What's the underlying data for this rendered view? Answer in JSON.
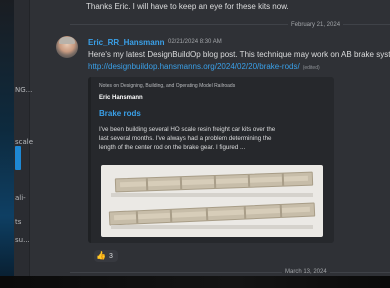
{
  "previous_message": {
    "text": "Thanks Eric.  I will have to keep an eye for these kits now."
  },
  "dividers": {
    "first_date": "February 21, 2024",
    "second_date": "March 13, 2024"
  },
  "sidebar": {
    "items": [
      {
        "label": "NG..."
      },
      {
        "label": "scale"
      },
      {
        "label": "ali-"
      },
      {
        "label": "ts"
      },
      {
        "label": "su..."
      }
    ]
  },
  "message": {
    "author": "Eric_RR_Hansmann",
    "timestamp": "02/21/2024 8:30 AM",
    "text": "Here's my latest DesignBuildOp blog post. This technique may work on AB brake systems",
    "link": "http://designbuildop.hansmanns.org/2024/02/20/brake-rods/",
    "edited_label": "(edited)"
  },
  "embed": {
    "provider": "Notes on Designing, Building, and Operating Model Railroads",
    "author": "Eric Hansmann",
    "title": "Brake rods",
    "description_lines": [
      "I've been building several HO scale resin freight car kits over the",
      "last several months. I've always had a problem determining the",
      "length of the center rod on the brake gear. I figured ..."
    ],
    "image_alt": "resin-freight-car-underframes-photo"
  },
  "reaction": {
    "emoji": "thumbs-up-icon",
    "count": "3"
  },
  "colors": {
    "link": "#3aa0e8",
    "background": "#2f3136",
    "embed_background": "#26282c",
    "text": "#dcddde"
  }
}
